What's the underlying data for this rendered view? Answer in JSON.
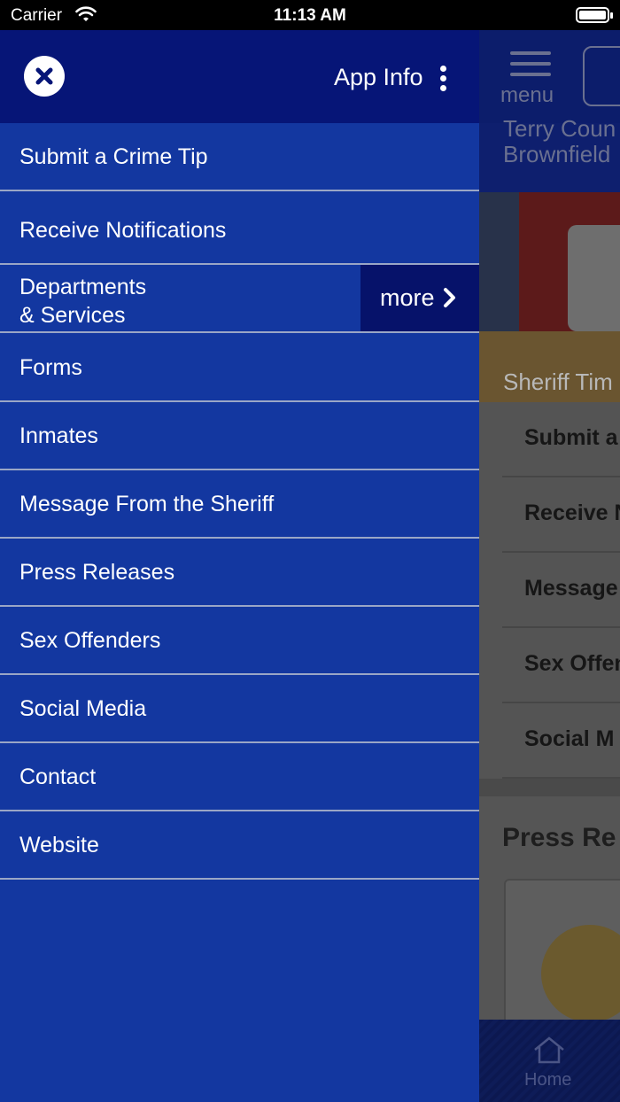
{
  "status_bar": {
    "carrier": "Carrier",
    "time": "11:13 AM"
  },
  "drawer": {
    "app_info_label": "App Info",
    "items": [
      {
        "label": "Submit a Crime Tip"
      },
      {
        "label": "Receive Notifications"
      },
      {
        "label": "Departments\n& Services",
        "more_label": "more"
      },
      {
        "label": "Forms"
      },
      {
        "label": "Inmates"
      },
      {
        "label": "Message From the Sheriff"
      },
      {
        "label": "Press Releases"
      },
      {
        "label": "Sex Offenders"
      },
      {
        "label": "Social Media"
      },
      {
        "label": "Contact"
      },
      {
        "label": "Website"
      }
    ]
  },
  "background_page": {
    "menu_label": "menu",
    "title_line1": "Terry Coun",
    "title_line2": "Brownfield",
    "photo_caption": "Sheriff Tim",
    "list_items": [
      "Submit a",
      "Receive N",
      "Message",
      "Sex Offen",
      "Social M"
    ],
    "section_title": "Press Re",
    "tabbar_home": "Home"
  },
  "colors": {
    "drawer_bg": "#1337a0",
    "drawer_header_bg": "#061577",
    "more_bg": "#06126a",
    "divider": "#9aa6c6"
  },
  "icons": {
    "close": "close-icon",
    "app_info": "kebab-icon",
    "more": "chevron-right-icon",
    "home": "home-icon"
  }
}
